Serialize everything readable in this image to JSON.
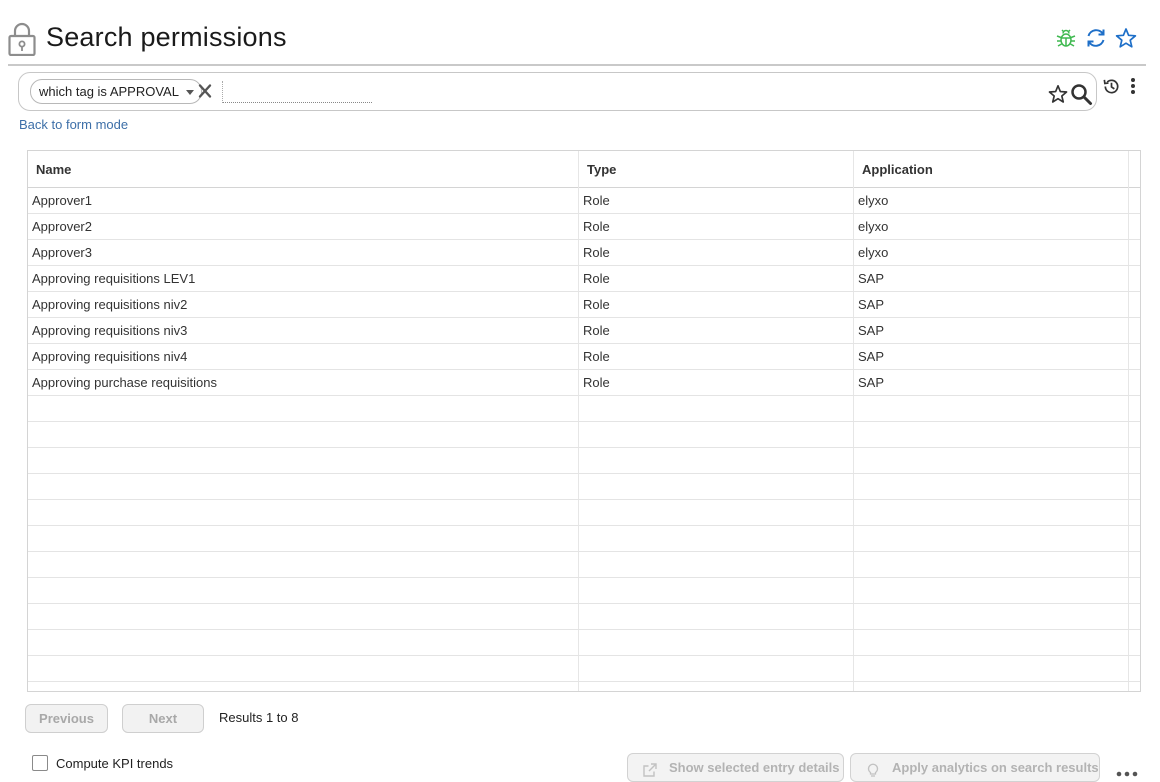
{
  "header": {
    "title": "Search permissions",
    "icons": [
      "lock-icon",
      "bug-icon",
      "refresh-icon",
      "star-icon"
    ],
    "colors": {
      "bug": "#3fb950",
      "refresh": "#1e6fc8",
      "star": "#1e6fc8"
    }
  },
  "search": {
    "chip_label": "which tag is APPROVAL",
    "input_value": "",
    "input_placeholder": "",
    "back_link": "Back to form mode"
  },
  "table": {
    "columns": [
      "Name",
      "Type",
      "Application"
    ],
    "rows": [
      {
        "name": "Approver1",
        "type": "Role",
        "application": "elyxo"
      },
      {
        "name": "Approver2",
        "type": "Role",
        "application": "elyxo"
      },
      {
        "name": "Approver3",
        "type": "Role",
        "application": "elyxo"
      },
      {
        "name": "Approving requisitions LEV1",
        "type": "Role",
        "application": "SAP"
      },
      {
        "name": "Approving requisitions niv2",
        "type": "Role",
        "application": "SAP"
      },
      {
        "name": "Approving requisitions niv3",
        "type": "Role",
        "application": "SAP"
      },
      {
        "name": "Approving requisitions niv4",
        "type": "Role",
        "application": "SAP"
      },
      {
        "name": "Approving purchase requisitions",
        "type": "Role",
        "application": "SAP"
      }
    ],
    "empty_rows": 11
  },
  "pagination": {
    "previous_label": "Previous",
    "next_label": "Next",
    "results_text": "Results 1 to 8"
  },
  "footer": {
    "kpi_label": "Compute KPI trends",
    "kpi_checked": false,
    "details_label": "Show selected entry details",
    "analytics_label": "Apply analytics on search results"
  }
}
